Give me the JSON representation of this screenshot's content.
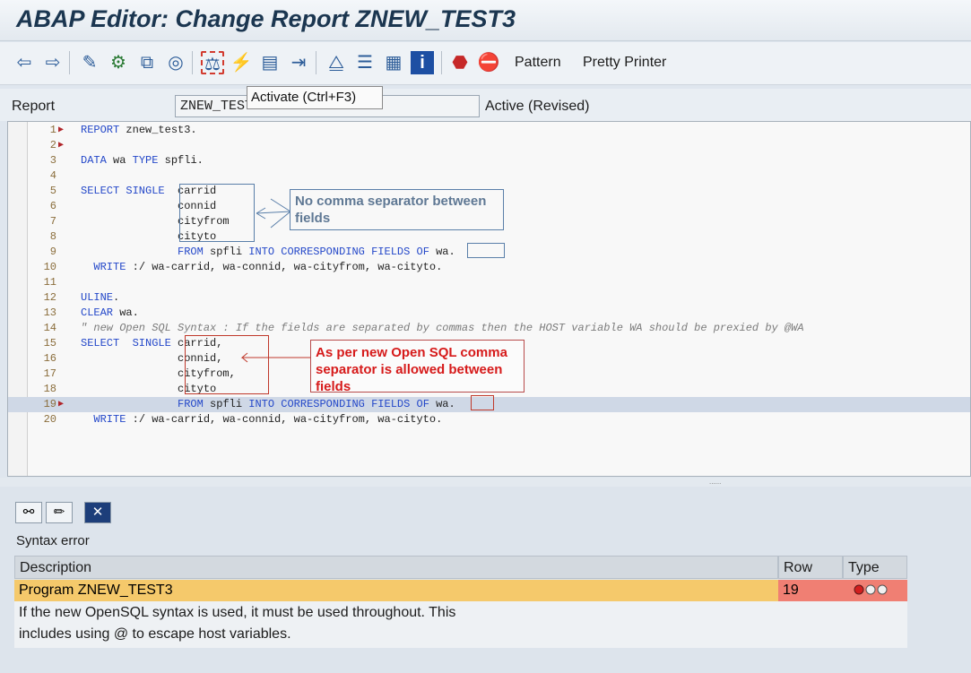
{
  "window": {
    "title": "ABAP Editor: Change Report ZNEW_TEST3"
  },
  "toolbar": {
    "icons": [
      "back-arrow-icon",
      "forward-arrow-icon",
      "display-change-icon",
      "other-object-icon",
      "activate-toggle-icon",
      "where-used-icon",
      "check-icon",
      "activate-icon",
      "test-icon",
      "object-list-icon",
      "navigation-window-icon",
      "hierarchy-icon",
      "stack-icon",
      "layout-icon",
      "info-icon",
      "set-breakpoint-icon",
      "stop-icon"
    ],
    "pattern_label": "Pattern",
    "pretty_printer_label": "Pretty Printer",
    "tooltip": "Activate   (Ctrl+F3)"
  },
  "report": {
    "label": "Report",
    "value": "ZNEW_TEST3",
    "status": "Active (Revised)"
  },
  "code_lines": [
    {
      "n": "1",
      "marker": true,
      "parts": [
        {
          "t": "REPORT",
          "k": "kw"
        },
        {
          "t": " znew_test3.",
          "k": ""
        }
      ]
    },
    {
      "n": "2",
      "marker": true,
      "parts": []
    },
    {
      "n": "3",
      "marker": false,
      "parts": [
        {
          "t": "DATA",
          "k": "kw"
        },
        {
          "t": " wa ",
          "k": ""
        },
        {
          "t": "TYPE",
          "k": "kw"
        },
        {
          "t": " spfli.",
          "k": ""
        }
      ]
    },
    {
      "n": "4",
      "marker": false,
      "parts": []
    },
    {
      "n": "5",
      "marker": false,
      "parts": [
        {
          "t": "SELECT SINGLE",
          "k": "kw"
        },
        {
          "t": "  carrid",
          "k": ""
        }
      ]
    },
    {
      "n": "6",
      "marker": false,
      "parts": [
        {
          "t": "               connid",
          "k": ""
        }
      ]
    },
    {
      "n": "7",
      "marker": false,
      "parts": [
        {
          "t": "               cityfrom",
          "k": ""
        }
      ]
    },
    {
      "n": "8",
      "marker": false,
      "parts": [
        {
          "t": "               cityto",
          "k": ""
        }
      ]
    },
    {
      "n": "9",
      "marker": false,
      "parts": [
        {
          "t": "               ",
          "k": ""
        },
        {
          "t": "FROM",
          "k": "kw"
        },
        {
          "t": " spfli ",
          "k": ""
        },
        {
          "t": "INTO CORRESPONDING FIELDS OF",
          "k": "kw"
        },
        {
          "t": " wa.",
          "k": ""
        }
      ]
    },
    {
      "n": "10",
      "marker": false,
      "parts": [
        {
          "t": "  ",
          "k": ""
        },
        {
          "t": "WRITE",
          "k": "kw"
        },
        {
          "t": " :/ wa-carrid, wa-connid, wa-cityfrom, wa-cityto.",
          "k": ""
        }
      ]
    },
    {
      "n": "11",
      "marker": false,
      "parts": []
    },
    {
      "n": "12",
      "marker": false,
      "parts": [
        {
          "t": "ULINE",
          "k": "kw"
        },
        {
          "t": ".",
          "k": ""
        }
      ]
    },
    {
      "n": "13",
      "marker": false,
      "parts": [
        {
          "t": "CLEAR",
          "k": "kw"
        },
        {
          "t": " wa.",
          "k": ""
        }
      ]
    },
    {
      "n": "14",
      "marker": false,
      "parts": [
        {
          "t": "\" new Open SQL Syntax : If the fields are separated by commas then the HOST variable WA should be prexied by @WA",
          "k": "cm"
        }
      ]
    },
    {
      "n": "15",
      "marker": false,
      "parts": [
        {
          "t": "SELECT  SINGLE",
          "k": "kw"
        },
        {
          "t": " carrid,",
          "k": ""
        }
      ]
    },
    {
      "n": "16",
      "marker": false,
      "parts": [
        {
          "t": "               connid,",
          "k": ""
        }
      ]
    },
    {
      "n": "17",
      "marker": false,
      "parts": [
        {
          "t": "               cityfrom,",
          "k": ""
        }
      ]
    },
    {
      "n": "18",
      "marker": false,
      "parts": [
        {
          "t": "               cityto",
          "k": ""
        }
      ]
    },
    {
      "n": "19",
      "marker": true,
      "hl": true,
      "parts": [
        {
          "t": "               ",
          "k": ""
        },
        {
          "t": "FROM",
          "k": "kw"
        },
        {
          "t": " spfli ",
          "k": ""
        },
        {
          "t": "INTO CORRESPONDING FIELDS OF",
          "k": "kw"
        },
        {
          "t": " wa.",
          "k": ""
        }
      ]
    },
    {
      "n": "20",
      "marker": false,
      "parts": [
        {
          "t": "  ",
          "k": ""
        },
        {
          "t": "WRITE",
          "k": "kw"
        },
        {
          "t": " :/ wa-carrid, wa-connid, wa-cityfrom, wa-cityto.",
          "k": ""
        }
      ]
    }
  ],
  "annotations": {
    "blue_note": "No comma separator between fields",
    "red_note": "As per new Open SQL comma separator is allowed between fields"
  },
  "bottom": {
    "buttons": [
      "glasses-icon",
      "pencil-icon",
      "close-x-icon"
    ],
    "syntax_label": "Syntax error",
    "headers": {
      "description": "Description",
      "row": "Row",
      "type": "Type"
    },
    "program_row": {
      "description": "Program ZNEW_TEST3",
      "row": "19"
    },
    "message_1": "If the new OpenSQL syntax is used, it must be used throughout. This",
    "message_2": "includes using @ to escape host variables."
  },
  "colors": {
    "highlight_row": "#f5c96b",
    "error_cell": "#f07f73"
  }
}
